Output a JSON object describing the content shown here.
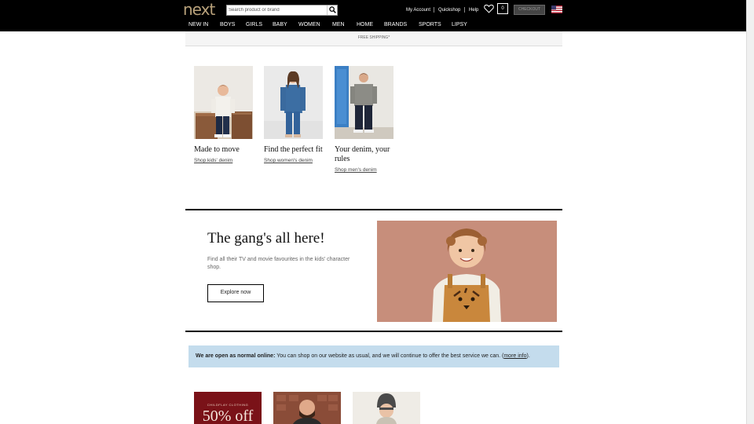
{
  "header": {
    "logo": "next",
    "search_placeholder": "Search product or brand",
    "my_account": "My Account",
    "quickshop": "Quickshop",
    "help": "Help",
    "bag_count": "0",
    "checkout": "CHECKOUT"
  },
  "nav": [
    "NEW IN",
    "BOYS",
    "GIRLS",
    "BABY",
    "WOMEN",
    "MEN",
    "HOME",
    "BRANDS",
    "SPORTS",
    "LIPSY"
  ],
  "promo_strip": "FREE SHIPPING*",
  "tiles": [
    {
      "title": "Made to move",
      "link": "Shop kids' denim"
    },
    {
      "title": "Find the perfect fit",
      "link": "Shop women's denim"
    },
    {
      "title": "Your denim, your rules",
      "link": "Shop men's denim"
    }
  ],
  "hero": {
    "title": "The gang's all here!",
    "text": "Find all their TV and movie favourites in the kids' character shop.",
    "button": "Explore now"
  },
  "notice": {
    "bold": "We are open as normal online:",
    "text": " You can shop on our website as usual, and we will continue to offer the best service we can. (",
    "link": "more info",
    "end": ")."
  },
  "bottom_tile_1": {
    "small_text": "CHILDFLAY CLOTHING",
    "big_text": "50% off"
  },
  "colors": {
    "header_bg": "#000000",
    "logo": "#b9a27b",
    "notice_bg": "#c4dced",
    "hero_bg": "#c88f7c"
  }
}
